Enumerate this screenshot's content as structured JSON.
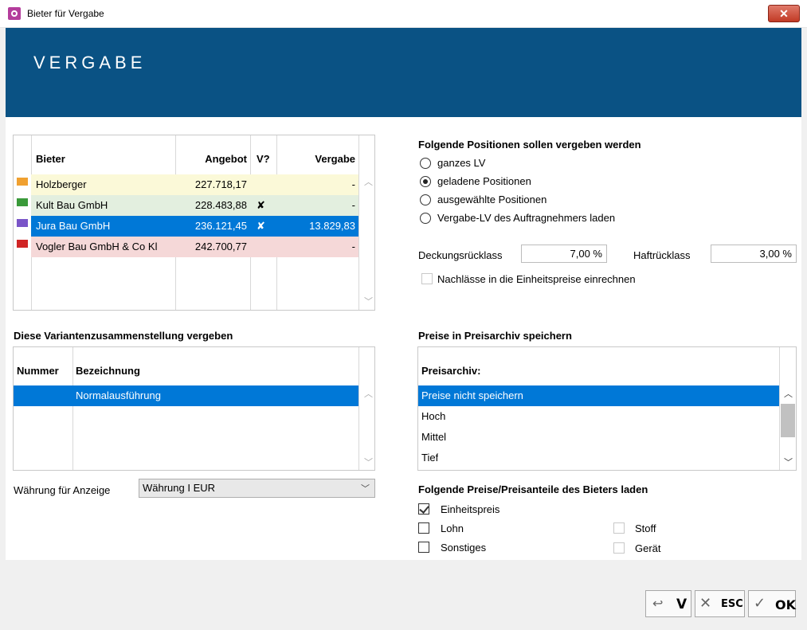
{
  "window": {
    "title": "Bieter für Vergabe",
    "close_glyph": "✕"
  },
  "header": {
    "title": "VERGABE"
  },
  "bidders": {
    "columns": {
      "bieter": "Bieter",
      "angebot": "Angebot",
      "v": "V?",
      "vergabe": "Vergabe"
    },
    "rows": [
      {
        "name": "Holzberger",
        "angebot": "227.718,17",
        "v": "",
        "vergabe": "-",
        "swatch": "#f0a030",
        "bg": "#fbf9d8"
      },
      {
        "name": "Kult Bau GmbH",
        "angebot": "228.483,88",
        "v": "✘",
        "vergabe": "-",
        "swatch": "#3a9a3a",
        "bg": "#e3efdf"
      },
      {
        "name": "Jura Bau GmbH",
        "angebot": "236.121,45",
        "v": "✘",
        "vergabe": "13.829,83",
        "swatch": "#7a55c8",
        "bg": "#0078d7"
      },
      {
        "name": "Vogler Bau GmbH & Co Kl",
        "angebot": "242.700,77",
        "v": "",
        "vergabe": "-",
        "swatch": "#d02525",
        "bg": "#f5d8d8"
      }
    ]
  },
  "positions": {
    "heading": "Folgende Positionen sollen vergeben werden",
    "options": [
      "ganzes LV",
      "geladene Positionen",
      "ausgewählte Positionen",
      "Vergabe-LV des Auftragnehmers laden"
    ],
    "selected": 1
  },
  "retention": {
    "deckung_label": "Deckungsrücklass",
    "deckung_value": "7,00 %",
    "haft_label": "Haftrücklass",
    "haft_value": "3,00 %",
    "nachlass_label": "Nachlässe in die Einheitspreise einrechnen"
  },
  "variants": {
    "heading": "Diese Variantenzusammenstellung vergeben",
    "col_nummer": "Nummer",
    "col_bezeichnung": "Bezeichnung",
    "rows": [
      {
        "nummer": "",
        "bezeichnung": "Normalausführung"
      }
    ]
  },
  "currency": {
    "label": "Währung für Anzeige",
    "value": "Währung I EUR"
  },
  "archive": {
    "heading": "Preise in Preisarchiv speichern",
    "column": "Preisarchiv:",
    "items": [
      "Preise nicht speichern",
      "Hoch",
      "Mittel",
      "Tief"
    ]
  },
  "price_parts": {
    "heading": "Folgende Preise/Preisanteile des Bieters laden",
    "einheitspreis": "Einheitspreis",
    "lohn": "Lohn",
    "sonstiges": "Sonstiges",
    "stoff": "Stoff",
    "geraet": "Gerät"
  },
  "buttons": {
    "back_label": "V",
    "esc_label": "ESC",
    "ok_label": "OK"
  },
  "colors": {
    "header": "#0a5284",
    "selection": "#0078d7"
  }
}
